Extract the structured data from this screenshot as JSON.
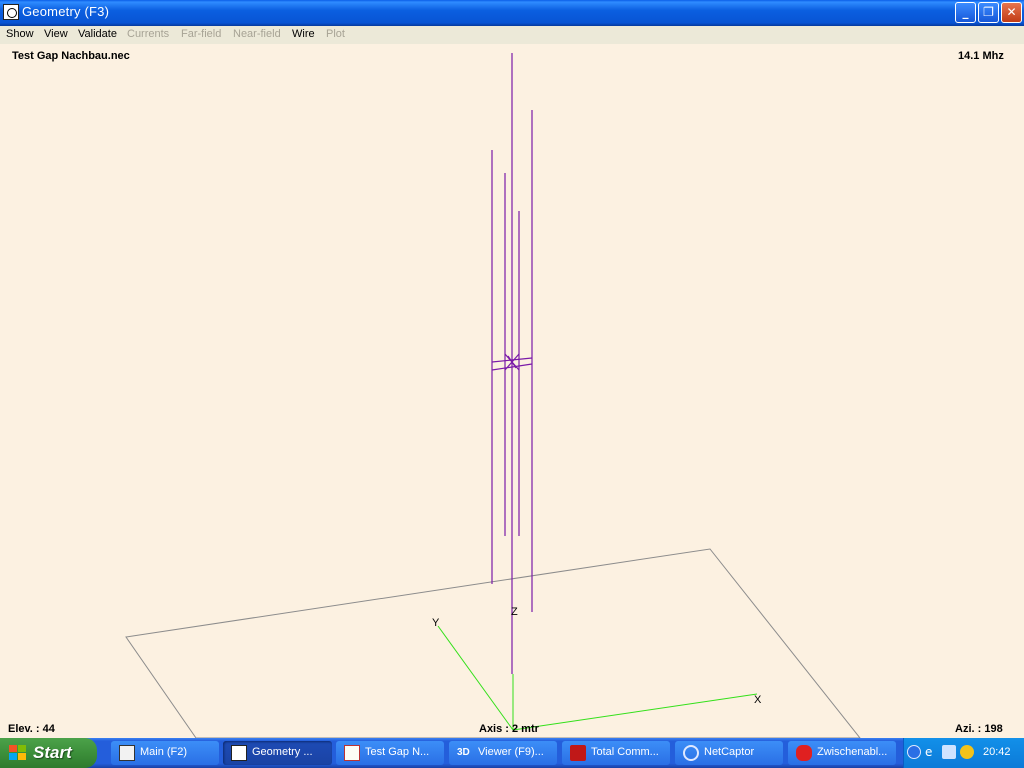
{
  "window": {
    "title": "Geometry   (F3)",
    "controls": [
      "minimize",
      "maximize",
      "close"
    ]
  },
  "menu": [
    {
      "label": "Show",
      "enabled": true
    },
    {
      "label": "View",
      "enabled": true
    },
    {
      "label": "Validate",
      "enabled": true
    },
    {
      "label": "Currents",
      "enabled": false
    },
    {
      "label": "Far-field",
      "enabled": false
    },
    {
      "label": "Near-field",
      "enabled": false
    },
    {
      "label": "Wire",
      "enabled": true
    },
    {
      "label": "Plot",
      "enabled": false
    }
  ],
  "view": {
    "filename": "Test Gap Nachbau.nec",
    "frequency": "14.1 Mhz",
    "elevation": "Elev. : 44",
    "axis": "Axis : 2 mtr",
    "azimuth": "Azi. : 198",
    "axis_labels": {
      "x": "X",
      "y": "Y",
      "z": "Z"
    },
    "colors": {
      "background": "#fcf1e1",
      "wire": "#7a1aa8",
      "axes": "#33e01a",
      "ground": "#8c8c8c"
    }
  },
  "taskbar": {
    "start_label": "Start",
    "items": [
      {
        "label": "Main   (F2)",
        "icon": "nec-main-icon",
        "active": false
      },
      {
        "label": "Geometry   ...",
        "icon": "geometry-icon",
        "active": true
      },
      {
        "label": "Test Gap N...",
        "icon": "notepad-icon",
        "active": false
      },
      {
        "label": "Viewer (F9)...",
        "icon": "3d-viewer-icon",
        "active": false
      },
      {
        "label": "Total Comm...",
        "icon": "total-commander-icon",
        "active": false
      },
      {
        "label": "NetCaptor",
        "icon": "netcaptor-icon",
        "active": false
      },
      {
        "label": "Zwischenabl...",
        "icon": "clipboard-icon",
        "active": false
      }
    ],
    "clock": "20:42"
  }
}
